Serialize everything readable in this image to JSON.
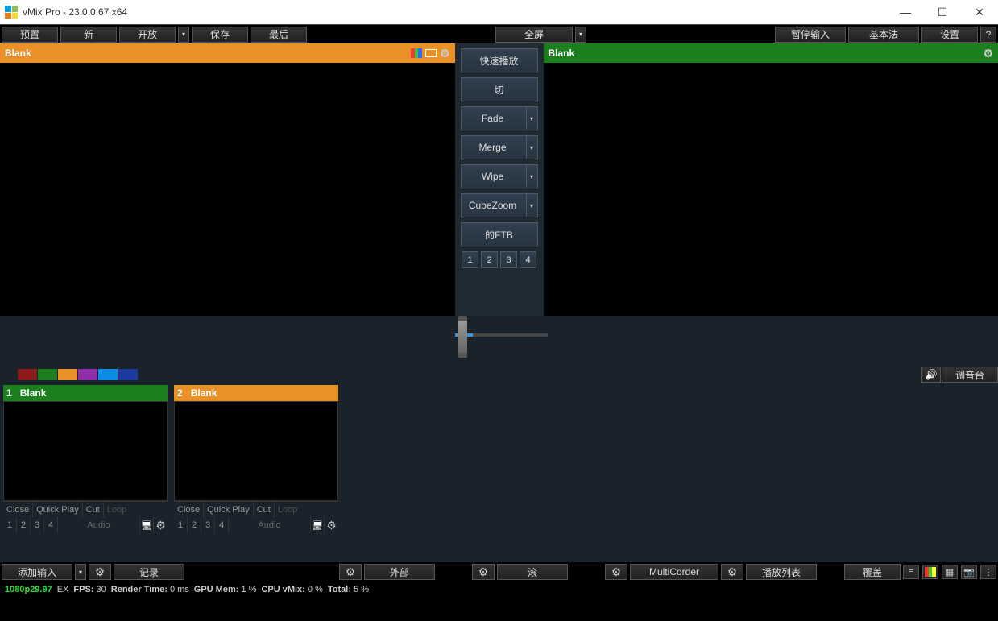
{
  "titlebar": {
    "title": "vMix Pro - 23.0.0.67 x64"
  },
  "toolbar": {
    "preset": "预置",
    "new": "新",
    "open": "开放",
    "save": "保存",
    "last": "最后",
    "fullscreen": "全屏",
    "pause_input": "暂停输入",
    "basic": "基本法",
    "settings": "设置",
    "help": "?"
  },
  "preview": {
    "label": "Blank"
  },
  "output": {
    "label": "Blank"
  },
  "center": {
    "quickplay": "快速播放",
    "cut": "切",
    "fade": "Fade",
    "merge": "Merge",
    "wipe": "Wipe",
    "cubezoom": "CubeZoom",
    "ftb": "的FTB",
    "nums": [
      "1",
      "2",
      "3",
      "4"
    ]
  },
  "mixer_label": "调音台",
  "colors": [
    "#8b1a1a",
    "#1b7f1d",
    "#e99126",
    "#8e2ea8",
    "#0c8ee8",
    "#1b3b9e"
  ],
  "inputs": [
    {
      "num": "1",
      "label": "Blank",
      "header_color": "green"
    },
    {
      "num": "2",
      "label": "Blank",
      "header_color": "orange"
    }
  ],
  "tile_ctrl": {
    "close": "Close",
    "quickplay": "Quick Play",
    "cut": "Cut",
    "loop": "Loop",
    "audio": "Audio",
    "nums": [
      "1",
      "2",
      "3",
      "4"
    ]
  },
  "bottom": {
    "add_input": "添加输入",
    "record": "记录",
    "external": "外部",
    "stream": "滚",
    "multicorder": "MultiCorder",
    "playlist": "播放列表",
    "overlay": "覆盖"
  },
  "status": {
    "res": "1080p29.97",
    "ex": "EX",
    "fps_l": "FPS:",
    "fps_v": "30",
    "rt_l": "Render Time:",
    "rt_v": "0 ms",
    "gpu_l": "GPU Mem:",
    "gpu_v": "1 %",
    "cpu_l": "CPU vMix:",
    "cpu_v": "0 %",
    "tot_l": "Total:",
    "tot_v": "5 %"
  }
}
